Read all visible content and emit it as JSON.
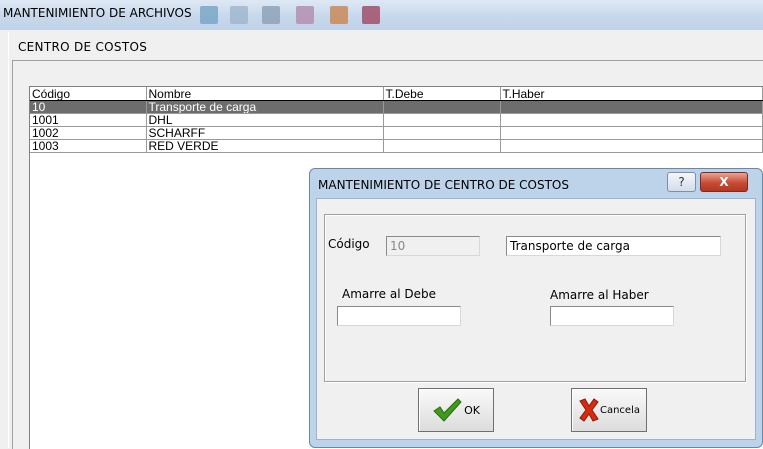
{
  "window": {
    "title": "MANTENIMIENTO DE ARCHIVOS"
  },
  "section": {
    "title": "CENTRO DE COSTOS"
  },
  "grid": {
    "columns": [
      "Código",
      "Nombre",
      "T.Debe",
      "T.Haber"
    ],
    "rows": [
      [
        "10",
        "Transporte de carga",
        "",
        ""
      ],
      [
        "1001",
        "DHL",
        "",
        ""
      ],
      [
        "1002",
        "SCHARFF",
        "",
        ""
      ],
      [
        "1003",
        "RED VERDE",
        "",
        ""
      ]
    ],
    "selected_row": 0
  },
  "dialog": {
    "title": "MANTENIMIENTO DE CENTRO DE COSTOS",
    "help_label": "?",
    "close_label": "X",
    "codigo_label": "Código",
    "codigo_value": "10",
    "nombre_value": "Transporte de carga",
    "amarre_debe_label": "Amarre al Debe",
    "amarre_debe_value": "",
    "amarre_haber_label": "Amarre al Haber",
    "amarre_haber_value": "",
    "ok_label": "OK",
    "cancel_label": "Cancela",
    "ok_icon": "checkmark-icon",
    "cancel_icon": "x-mark-icon"
  },
  "colors": {
    "selection": "#6d6d6d",
    "dialog_frame": "#bcd3ea",
    "ok_icon": "#3f9a1e",
    "cancel_icon": "#d62a12"
  }
}
